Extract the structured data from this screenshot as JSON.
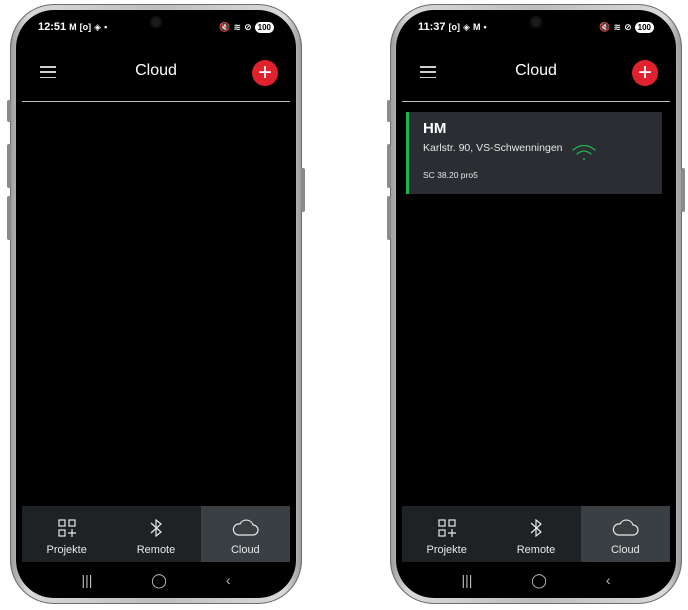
{
  "left_phone": {
    "status": {
      "time": "12:51",
      "left_icons": [
        "M",
        "[o]",
        "◈",
        "•"
      ],
      "right_icons": [
        "🔇",
        "≋",
        "⊘"
      ],
      "battery": "100"
    },
    "header": {
      "title": "Cloud",
      "menu_icon": "hamburger-icon",
      "add_label": "+"
    },
    "bottom_nav": [
      {
        "label": "Projekte",
        "icon": "grid-add-icon",
        "active": false
      },
      {
        "label": "Remote",
        "icon": "bluetooth-icon",
        "active": false
      },
      {
        "label": "Cloud",
        "icon": "cloud-icon",
        "active": true
      }
    ],
    "system_nav": {
      "recents": "|||",
      "home": "◯",
      "back": "‹"
    }
  },
  "right_phone": {
    "status": {
      "time": "11:37",
      "left_icons": [
        "[o]",
        "◈",
        "M",
        "•"
      ],
      "right_icons": [
        "🔇",
        "≋",
        "⊘"
      ],
      "battery": "100"
    },
    "header": {
      "title": "Cloud",
      "menu_icon": "hamburger-icon",
      "add_label": "+"
    },
    "card": {
      "name": "HM",
      "address": "Karlstr. 90, VS-Schwenningen",
      "version": "SC 38.20 pro5",
      "status_icon": "wifi-icon",
      "accent": "#22b24c"
    },
    "bottom_nav": [
      {
        "label": "Projekte",
        "icon": "grid-add-icon",
        "active": false
      },
      {
        "label": "Remote",
        "icon": "bluetooth-icon",
        "active": false
      },
      {
        "label": "Cloud",
        "icon": "cloud-icon",
        "active": true
      }
    ],
    "system_nav": {
      "recents": "|||",
      "home": "◯",
      "back": "‹"
    }
  },
  "colors": {
    "accent_red": "#e0222e",
    "nav_active": "#3a3f43",
    "card_bg": "#2a2e33"
  }
}
